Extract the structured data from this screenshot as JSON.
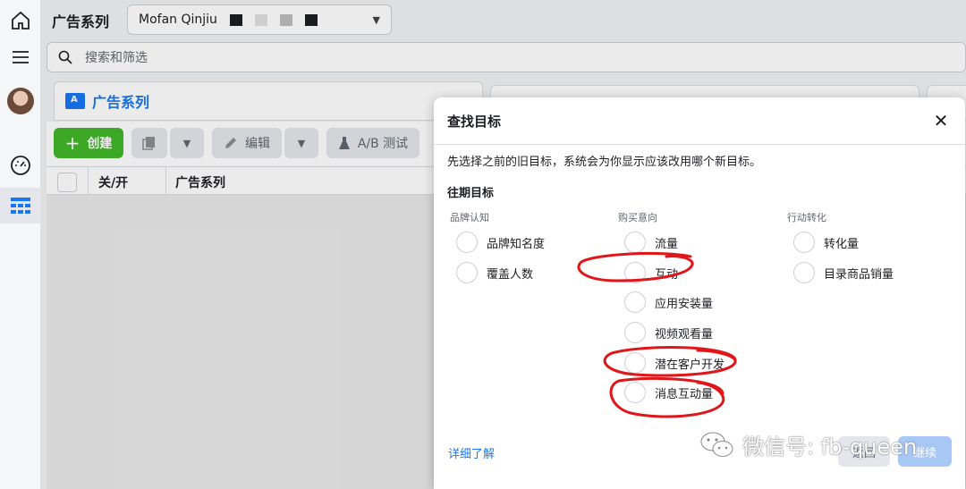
{
  "header": {
    "title": "广告系列",
    "account_name": "Mofan Qinjiu"
  },
  "search": {
    "placeholder": "搜索和筛选"
  },
  "campaign_tab": {
    "label": "广告系列"
  },
  "toolbar": {
    "create_label": "创建",
    "edit_label": "编辑",
    "ab_test_label": "A/B 测试"
  },
  "table": {
    "columns": [
      "关/开",
      "广告系列"
    ]
  },
  "modal": {
    "title": "查找目标",
    "description": "先选择之前的旧目标，系统会为你显示应该改用哪个新目标。",
    "section_title": "往期目标",
    "columns": [
      {
        "heading": "品牌认知",
        "options": [
          "品牌知名度",
          "覆盖人数"
        ]
      },
      {
        "heading": "购买意向",
        "options": [
          "流量",
          "互动",
          "应用安装量",
          "视频观看量",
          "潜在客户开发",
          "消息互动量"
        ]
      },
      {
        "heading": "行动转化",
        "options": [
          "转化量",
          "目录商品销量"
        ]
      }
    ],
    "learn_more": "详细了解",
    "back_label": "返回",
    "confirm_label": "继续"
  },
  "annotations": {
    "color": "#e0161a",
    "circled_options": [
      "互动",
      "潜在客户开发",
      "消息互动量"
    ]
  },
  "watermark": {
    "text": "微信号: fb-queen"
  },
  "colors": {
    "primary": "#1877f2",
    "create_green": "#42b72a"
  }
}
